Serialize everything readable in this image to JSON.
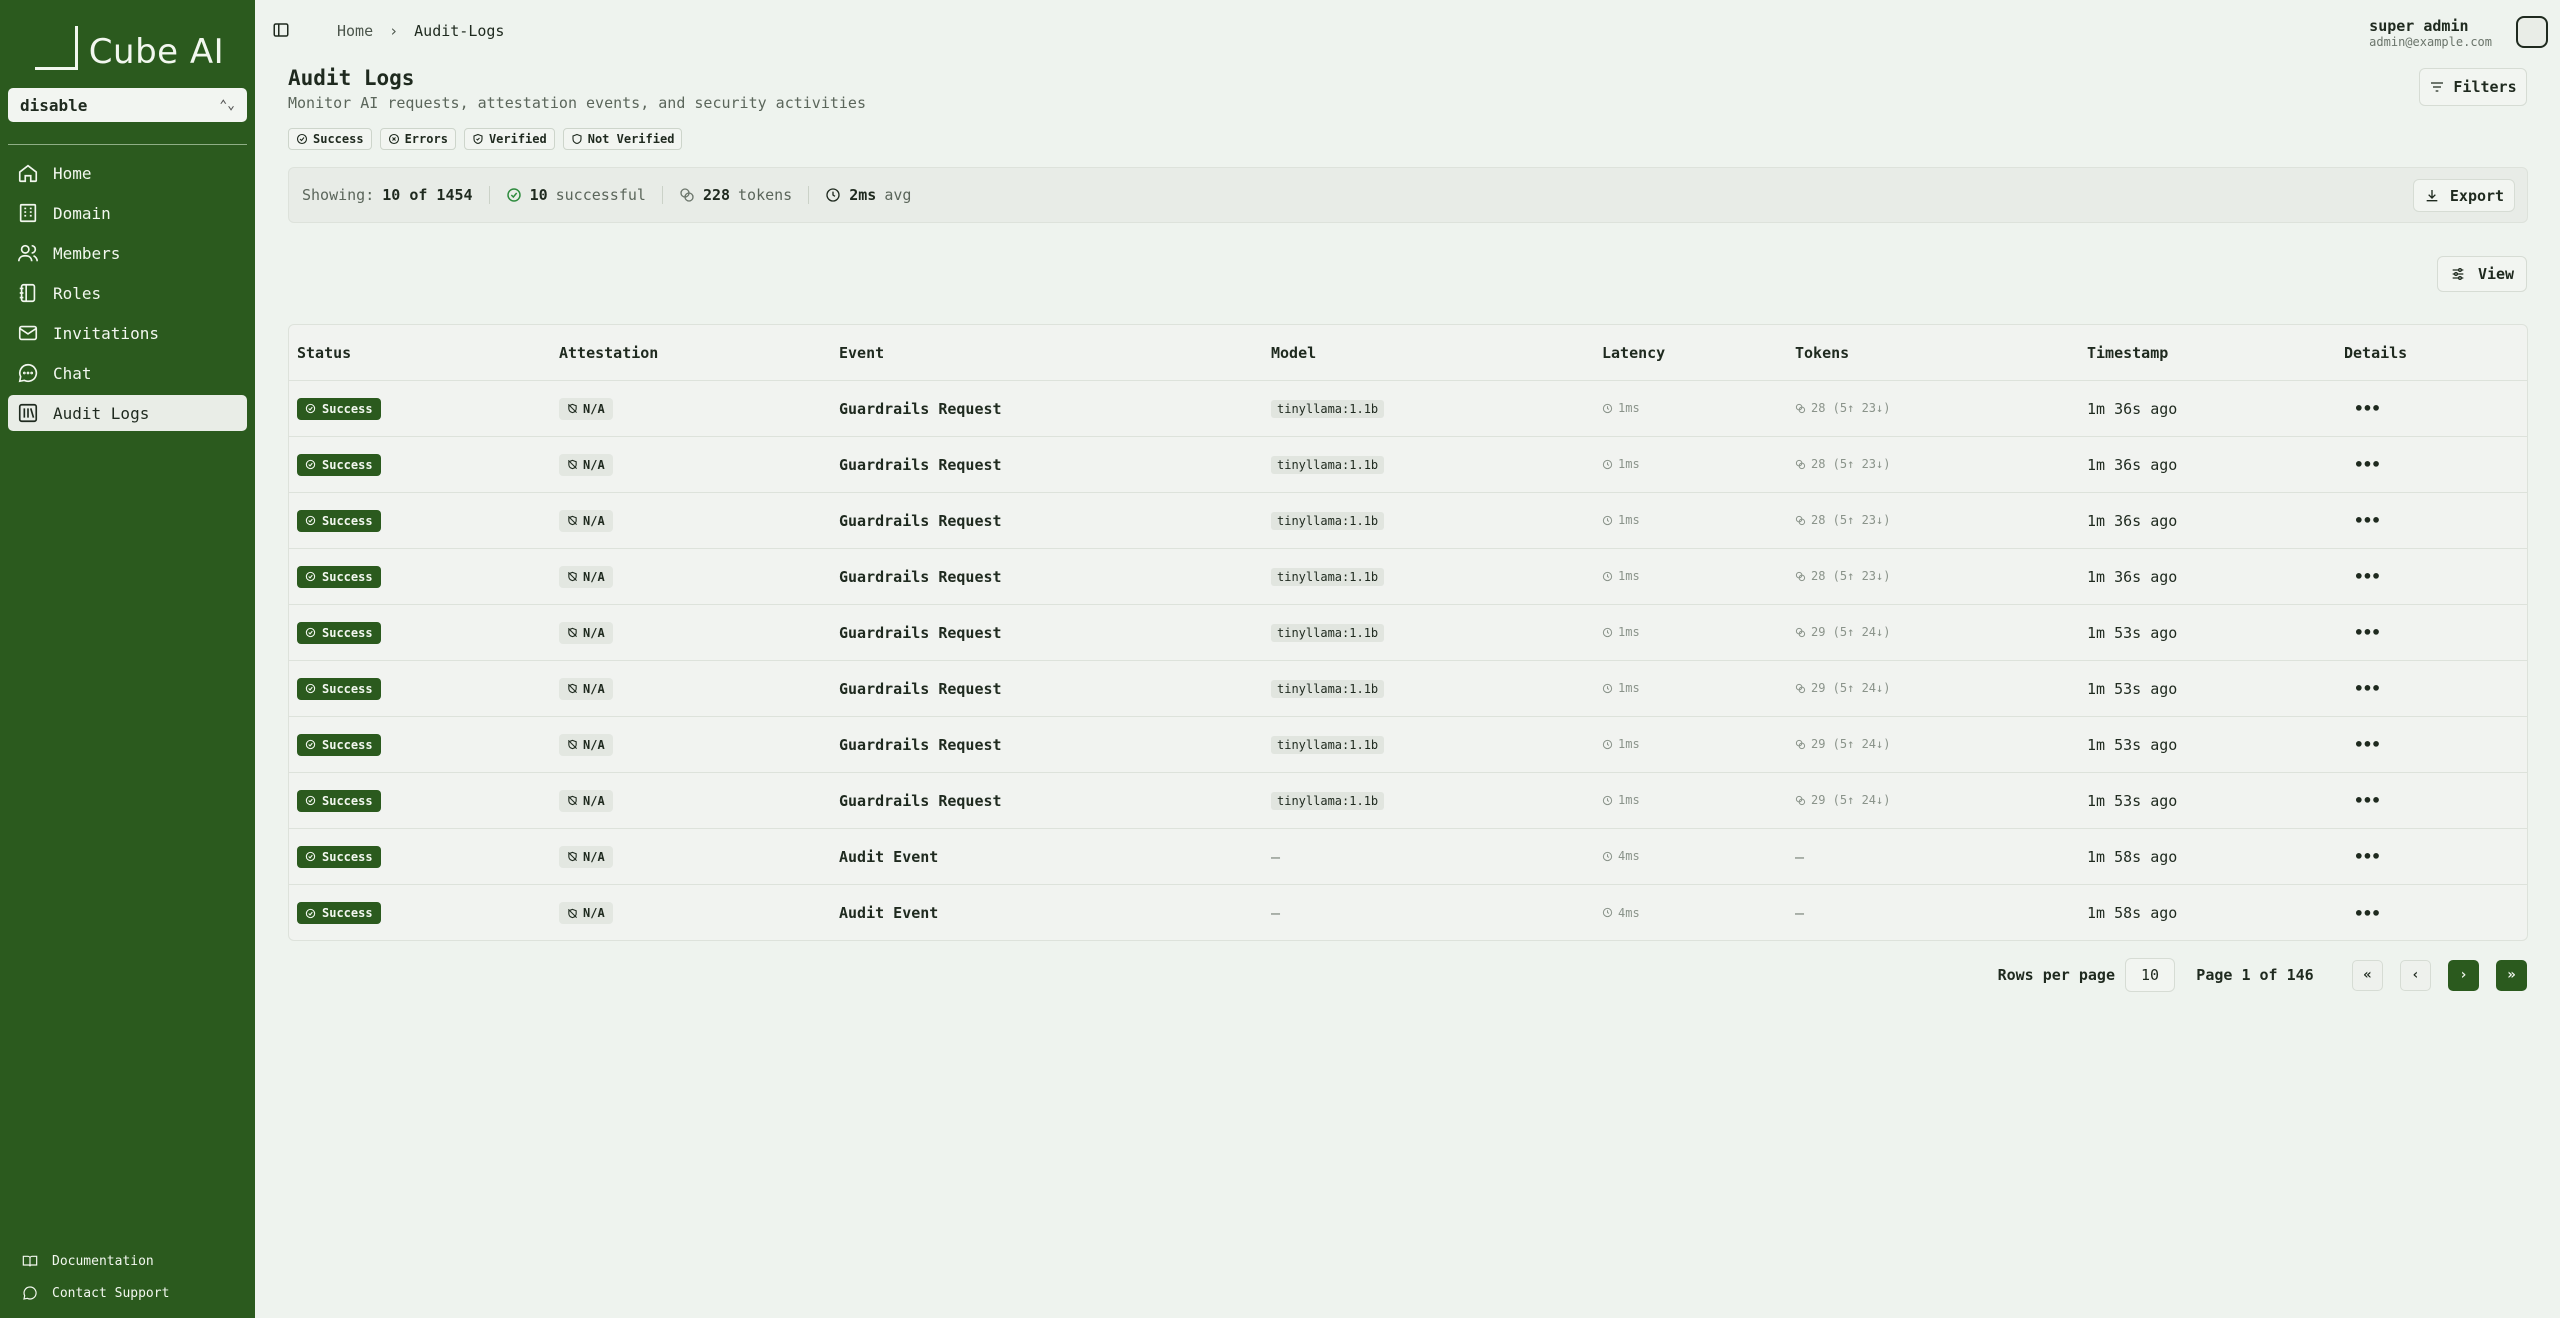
{
  "app": {
    "name": "Cube AI"
  },
  "domain_select": {
    "value": "disable"
  },
  "nav": [
    {
      "label": "Home",
      "icon": "home-icon"
    },
    {
      "label": "Domain",
      "icon": "building-icon"
    },
    {
      "label": "Members",
      "icon": "users-icon"
    },
    {
      "label": "Roles",
      "icon": "notebook-icon"
    },
    {
      "label": "Invitations",
      "icon": "mail-icon"
    },
    {
      "label": "Chat",
      "icon": "chat-icon"
    },
    {
      "label": "Audit Logs",
      "icon": "library-icon"
    }
  ],
  "bottom_links": {
    "documentation": "Documentation",
    "support": "Contact Support"
  },
  "breadcrumb": {
    "home": "Home",
    "current": "Audit-Logs"
  },
  "user": {
    "name": "super admin",
    "email": "admin@example.com"
  },
  "page": {
    "title": "Audit Logs",
    "subtitle": "Monitor AI requests, attestation events, and security activities",
    "filters_label": "Filters",
    "chips": [
      "Success",
      "Errors",
      "Verified",
      "Not Verified"
    ]
  },
  "stats": {
    "showing_label": "Showing:",
    "showing_value": "10 of 1454",
    "successful_value": "10",
    "successful_label": "successful",
    "tokens_value": "228",
    "tokens_label": "tokens",
    "latency_value": "2ms",
    "latency_label": "avg",
    "export_label": "Export"
  },
  "view_label": "View",
  "table": {
    "columns": [
      "Status",
      "Attestation",
      "Event",
      "Model",
      "Latency",
      "Tokens",
      "Timestamp",
      "Details"
    ],
    "rows": [
      {
        "status": "Success",
        "attestation": "N/A",
        "event": "Guardrails Request",
        "model": "tinyllama:1.1b",
        "latency": "1ms",
        "tokens": "28 (5↑ 23↓)",
        "timestamp": "1m 36s ago"
      },
      {
        "status": "Success",
        "attestation": "N/A",
        "event": "Guardrails Request",
        "model": "tinyllama:1.1b",
        "latency": "1ms",
        "tokens": "28 (5↑ 23↓)",
        "timestamp": "1m 36s ago"
      },
      {
        "status": "Success",
        "attestation": "N/A",
        "event": "Guardrails Request",
        "model": "tinyllama:1.1b",
        "latency": "1ms",
        "tokens": "28 (5↑ 23↓)",
        "timestamp": "1m 36s ago"
      },
      {
        "status": "Success",
        "attestation": "N/A",
        "event": "Guardrails Request",
        "model": "tinyllama:1.1b",
        "latency": "1ms",
        "tokens": "28 (5↑ 23↓)",
        "timestamp": "1m 36s ago"
      },
      {
        "status": "Success",
        "attestation": "N/A",
        "event": "Guardrails Request",
        "model": "tinyllama:1.1b",
        "latency": "1ms",
        "tokens": "29 (5↑ 24↓)",
        "timestamp": "1m 53s ago"
      },
      {
        "status": "Success",
        "attestation": "N/A",
        "event": "Guardrails Request",
        "model": "tinyllama:1.1b",
        "latency": "1ms",
        "tokens": "29 (5↑ 24↓)",
        "timestamp": "1m 53s ago"
      },
      {
        "status": "Success",
        "attestation": "N/A",
        "event": "Guardrails Request",
        "model": "tinyllama:1.1b",
        "latency": "1ms",
        "tokens": "29 (5↑ 24↓)",
        "timestamp": "1m 53s ago"
      },
      {
        "status": "Success",
        "attestation": "N/A",
        "event": "Guardrails Request",
        "model": "tinyllama:1.1b",
        "latency": "1ms",
        "tokens": "29 (5↑ 24↓)",
        "timestamp": "1m 53s ago"
      },
      {
        "status": "Success",
        "attestation": "N/A",
        "event": "Audit Event",
        "model": "—",
        "latency": "4ms",
        "tokens": "—",
        "timestamp": "1m 58s ago"
      },
      {
        "status": "Success",
        "attestation": "N/A",
        "event": "Audit Event",
        "model": "—",
        "latency": "4ms",
        "tokens": "—",
        "timestamp": "1m 58s ago"
      }
    ]
  },
  "pagination": {
    "rows_per_page_label": "Rows per page",
    "rows_per_page": "10",
    "page_info": "Page 1 of 146",
    "first": "«",
    "prev": "‹",
    "next": "›",
    "last": "»"
  },
  "colors": {
    "accent": "#2b5a1e",
    "background": "#eef3ee"
  }
}
